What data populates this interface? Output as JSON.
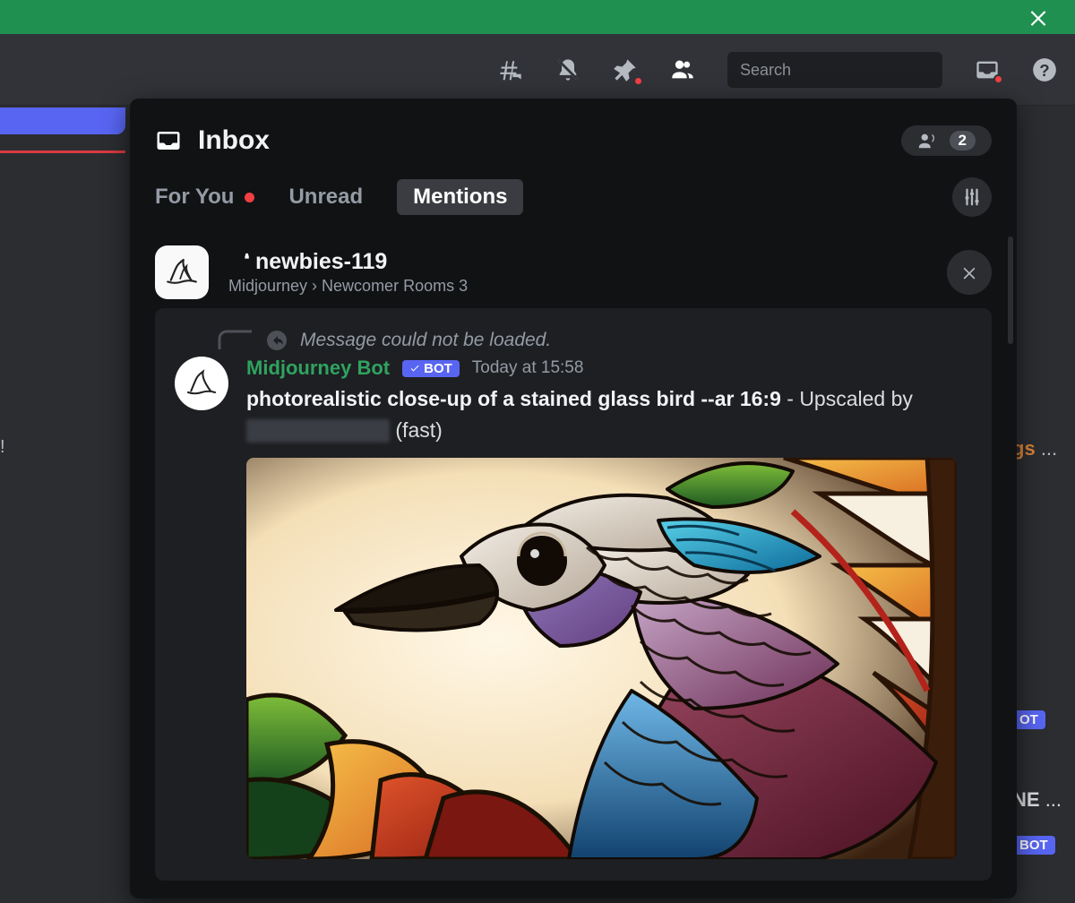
{
  "toolbar": {
    "search_placeholder": "Search"
  },
  "inbox": {
    "title": "Inbox",
    "voice_count": "2",
    "tabs": {
      "for_you": "For You",
      "unread": "Unread",
      "mentions": "Mentions"
    }
  },
  "mention": {
    "channel": "newbies-119",
    "server": "Midjourney",
    "category": "Newcomer Rooms 3",
    "reply_error": "Message could not be loaded.",
    "author": "Midjourney Bot",
    "bot_tag_text": "BOT",
    "timestamp": "Today at 15:58",
    "prompt_bold": "photorealistic close-up of a stained glass bird --ar 16:9",
    "suffix_before": " - Upscaled by ",
    "suffix_after": " (fast)"
  },
  "gutter": {
    "frag1": "gs",
    "frag2": "OT",
    "frag3": "NE",
    "bot": "BOT",
    "ellipsis": "..."
  },
  "left": {
    "excl": "!"
  }
}
